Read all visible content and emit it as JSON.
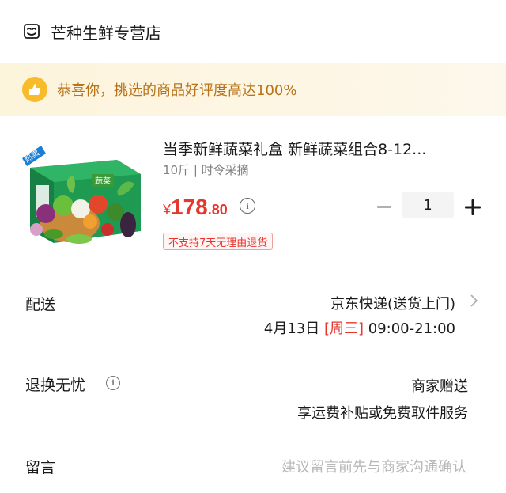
{
  "store": {
    "name": "芒种生鲜专营店",
    "icon": "store-icon"
  },
  "praise": {
    "text": "恭喜你，挑选的商品好评度高达100%",
    "icon": "thumbs-up-icon",
    "color": "#b8731a"
  },
  "product": {
    "title": "当季新鲜蔬菜礼盒 新鲜蔬菜组合8-12...",
    "spec": "10斤 | 时令采摘",
    "price_currency": "¥",
    "price_int": "178",
    "price_dec": ".80",
    "image_tag": "热卖",
    "box_label": "蔬菜",
    "quantity": "1",
    "return_badge": "不支持7天无理由退货",
    "price_color": "#e8362e"
  },
  "delivery": {
    "label": "配送",
    "carrier": "京东快递(送货上门)",
    "date": "4月13日",
    "weekday": "[周三]",
    "time": "09:00-21:00"
  },
  "returns": {
    "label": "退换无忧",
    "title": "商家赠送",
    "desc": "享运费补贴或免费取件服务"
  },
  "message": {
    "label": "留言",
    "placeholder": "建议留言前先与商家沟通确认"
  }
}
